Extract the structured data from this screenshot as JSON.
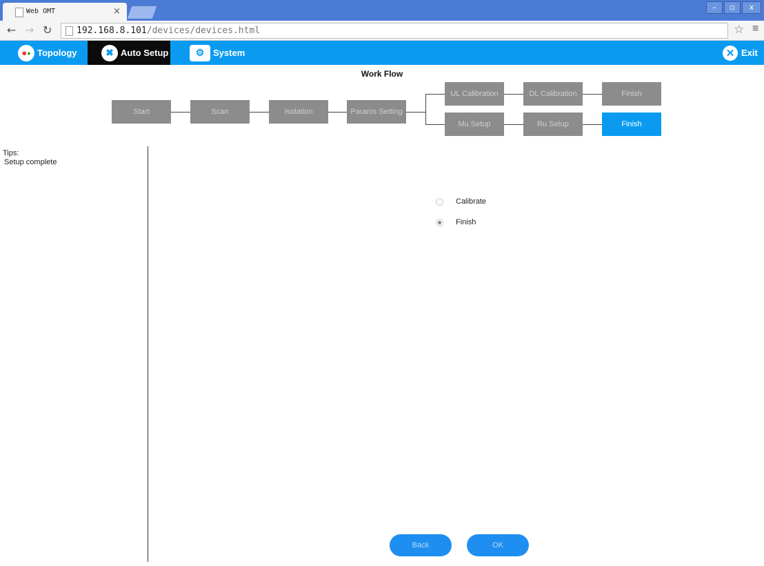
{
  "browser": {
    "tab_title": "Web OMT",
    "tab_close": "×",
    "url_host": "192.168.8.101",
    "url_path": "/devices/devices.html",
    "win_minimize": "–",
    "win_restore": "▫",
    "win_close": "x"
  },
  "appbar": {
    "items": [
      {
        "label": "Topology"
      },
      {
        "label": "Auto Setup"
      },
      {
        "label": "System"
      }
    ],
    "exit_label": "Exit",
    "active_color": "#0b0b0b",
    "bar_color": "#0a9bf0"
  },
  "workflow": {
    "title": "Work Flow",
    "steps": {
      "start": "Start",
      "scan": "Scan",
      "isolation": "Isolation",
      "params": "Params Setting",
      "ul_cal": "UL Calibration",
      "dl_cal": "DL Calibration",
      "finish_top": "Finish",
      "mu_setup": "Mu Setup",
      "ru_setup": "Ru Setup",
      "finish_bottom": "Finish"
    },
    "active_step": "finish_bottom"
  },
  "tips": {
    "label": "Tips:",
    "text": "Setup complete"
  },
  "options": {
    "items": [
      {
        "label": "Calibrate",
        "selected": false
      },
      {
        "label": "Finish",
        "selected": true
      }
    ]
  },
  "buttons": {
    "back": "Back",
    "ok": "OK"
  }
}
